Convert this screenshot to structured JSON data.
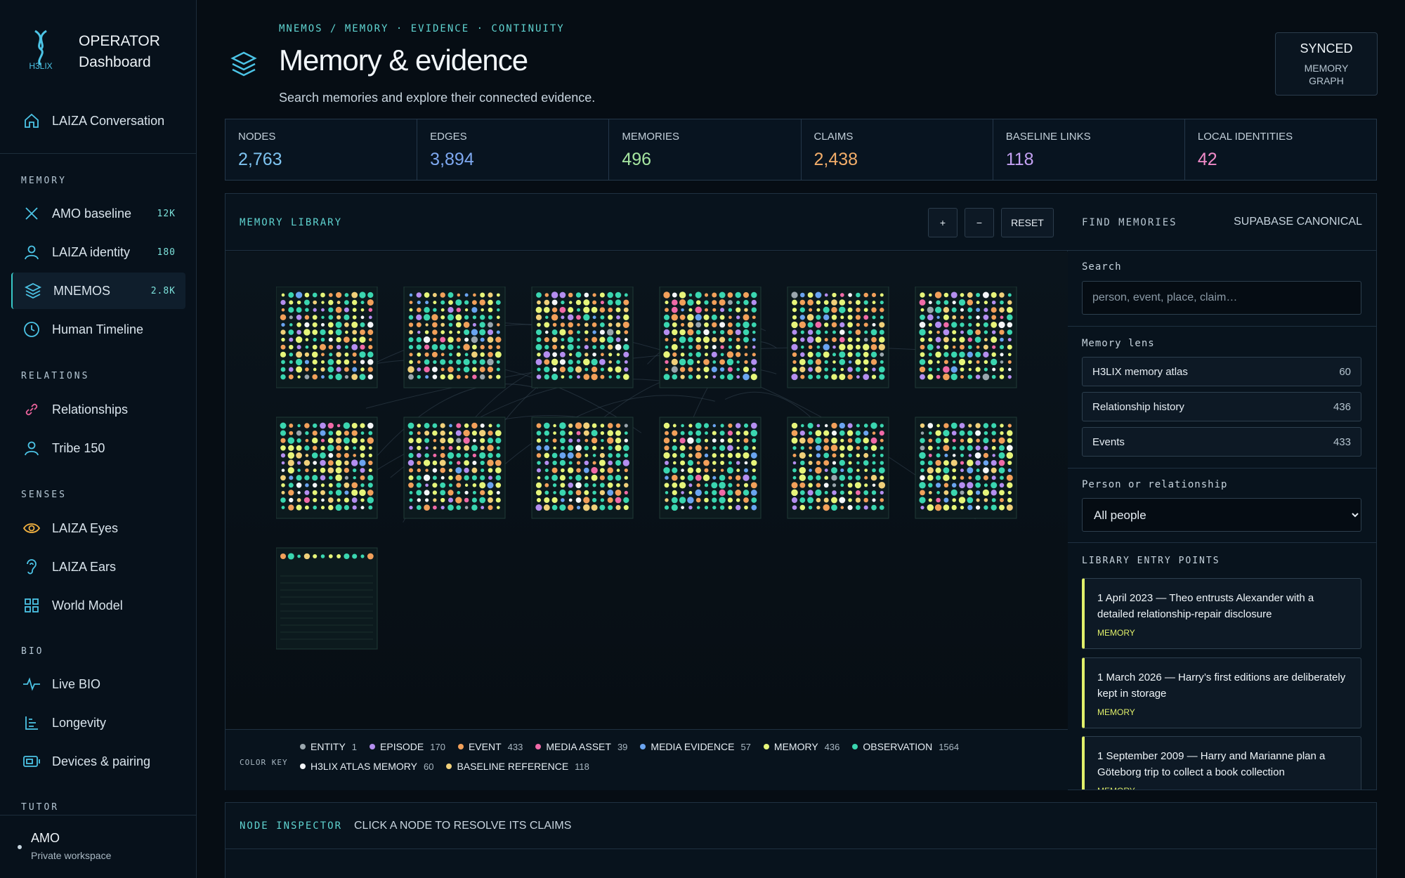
{
  "brand": {
    "logo_text": "H3LIX",
    "title_1": "OPERATOR",
    "title_2": "Dashboard"
  },
  "nav": {
    "conversation": {
      "label": "LAIZA Conversation"
    },
    "memory_section": "MEMORY",
    "memory_items": [
      {
        "label": "AMO baseline",
        "count": "12K",
        "icon": "x-icon"
      },
      {
        "label": "LAIZA identity",
        "count": "180",
        "icon": "person-icon"
      },
      {
        "label": "MNEMOS",
        "count": "2.8K",
        "icon": "layers-icon"
      },
      {
        "label": "Human Timeline",
        "count": "",
        "icon": "clock-icon"
      }
    ],
    "relations_section": "RELATIONS",
    "relations_items": [
      {
        "label": "Relationships",
        "icon": "link-icon"
      },
      {
        "label": "Tribe 150",
        "icon": "person-icon"
      }
    ],
    "senses_section": "SENSES",
    "senses_items": [
      {
        "label": "LAIZA Eyes",
        "icon": "eye-icon"
      },
      {
        "label": "LAIZA Ears",
        "icon": "ear-icon"
      },
      {
        "label": "World Model",
        "icon": "grid-icon"
      }
    ],
    "bio_section": "BIO",
    "bio_items": [
      {
        "label": "Live BIO",
        "icon": "pulse-icon"
      },
      {
        "label": "Longevity",
        "icon": "bars-icon"
      },
      {
        "label": "Devices & pairing",
        "icon": "device-icon"
      }
    ],
    "tutor_section": "TUTOR"
  },
  "workspace": {
    "name": "AMO",
    "sub": "Private workspace"
  },
  "header": {
    "breadcrumb": "MNEMOS / MEMORY · EVIDENCE · CONTINUITY",
    "title": "Memory & evidence",
    "subtitle": "Search memories and explore their connected evidence.",
    "status": "SYNCED",
    "status_sub": "MEMORY GRAPH"
  },
  "stats": [
    {
      "label": "NODES",
      "value": "2,763",
      "color": "#7ec3f0"
    },
    {
      "label": "EDGES",
      "value": "3,894",
      "color": "#7ea8f0"
    },
    {
      "label": "MEMORIES",
      "value": "496",
      "color": "#a6e6a0"
    },
    {
      "label": "CLAIMS",
      "value": "2,438",
      "color": "#f2ad6a"
    },
    {
      "label": "BASELINE LINKS",
      "value": "118",
      "color": "#c3a0f2"
    },
    {
      "label": "LOCAL IDENTITIES",
      "value": "42",
      "color": "#f08ac8"
    }
  ],
  "library": {
    "title": "MEMORY LIBRARY",
    "zoom_in": "+",
    "zoom_out": "−",
    "reset": "RESET",
    "color_key_label": "COLOR KEY",
    "color_key": [
      {
        "label": "ENTITY",
        "count": "1",
        "color": "#9aa6ad"
      },
      {
        "label": "EPISODE",
        "count": "170",
        "color": "#b48ef0"
      },
      {
        "label": "EVENT",
        "count": "433",
        "color": "#f2a05a"
      },
      {
        "label": "MEDIA ASSET",
        "count": "39",
        "color": "#f06aa8"
      },
      {
        "label": "MEDIA EVIDENCE",
        "count": "57",
        "color": "#6aa4f0"
      },
      {
        "label": "MEMORY",
        "count": "436",
        "color": "#e6f57a"
      },
      {
        "label": "OBSERVATION",
        "count": "1564",
        "color": "#3ad6b0"
      },
      {
        "label": "H3LIX ATLAS MEMORY",
        "count": "60",
        "color": "#f4f6f8"
      },
      {
        "label": "BASELINE REFERENCE",
        "count": "118",
        "color": "#f0d07a"
      }
    ]
  },
  "find": {
    "title": "FIND MEMORIES",
    "source": "SUPABASE CANONICAL",
    "search_label": "Search",
    "search_placeholder": "person, event, place, claim…",
    "lens_label": "Memory lens",
    "lenses": [
      {
        "label": "H3LIX memory atlas",
        "count": "60"
      },
      {
        "label": "Relationship history",
        "count": "436"
      },
      {
        "label": "Events",
        "count": "433"
      }
    ],
    "person_label": "Person or relationship",
    "person_value": "All people",
    "entry_label": "LIBRARY ENTRY POINTS",
    "entries": [
      {
        "text": "1 April 2023 — Theo entrusts Alexander with a detailed relationship-repair disclosure",
        "kind": "MEMORY"
      },
      {
        "text": "1 March 2026 — Harry’s first editions are deliberately kept in storage",
        "kind": "MEMORY"
      },
      {
        "text": "1 September 2009 — Harry and Marianne plan a Göteborg trip to collect a book collection",
        "kind": "MEMORY"
      }
    ]
  },
  "inspector": {
    "title": "NODE INSPECTOR",
    "hint": "CLICK A NODE TO RESOLVE ITS CLAIMS"
  }
}
